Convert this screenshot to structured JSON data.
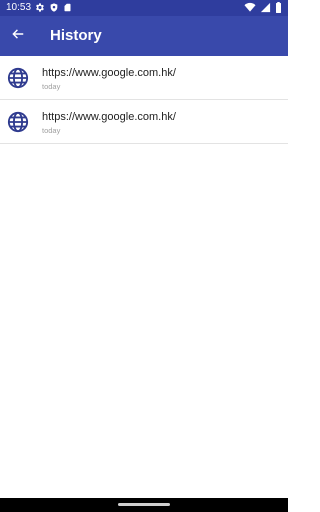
{
  "status_bar": {
    "time": "10:53",
    "icons": [
      "gear-icon",
      "shield-icon",
      "sim-card-icon",
      "wifi-icon",
      "signal-icon",
      "battery-icon"
    ]
  },
  "app_bar": {
    "title": "History",
    "back_icon": "arrow-left-icon",
    "color": "#3949ab"
  },
  "history": {
    "items": [
      {
        "url": "https://www.google.com.hk/",
        "date": "today",
        "icon": "globe-icon"
      },
      {
        "url": "https://www.google.com.hk/",
        "date": "today",
        "icon": "globe-icon"
      }
    ]
  },
  "colors": {
    "status_bar": "#2f3d9e",
    "accent": "#3949ab",
    "globe": "#2f3b8f"
  }
}
